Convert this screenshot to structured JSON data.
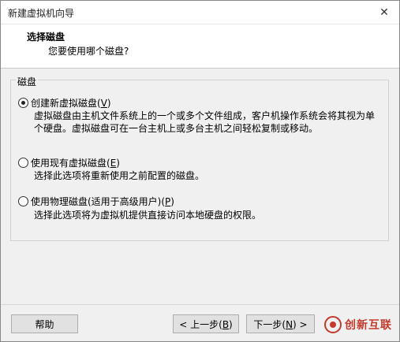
{
  "window": {
    "title": "新建虚拟机向导",
    "close_glyph": "✕"
  },
  "header": {
    "title": "选择磁盘",
    "subtitle": "您要使用哪个磁盘?"
  },
  "group": {
    "label": "磁盘"
  },
  "options": [
    {
      "label": "创建新虚拟磁盘(",
      "hotkey": "V",
      "suffix": ")",
      "checked": true,
      "desc_lines": [
        "虚拟磁盘由主机文件系统上的一个或多个文件组成，客户机操作系统会将其视为单",
        "个硬盘。虚拟磁盘可在一台主机上或多台主机之间轻松复制或移动。"
      ]
    },
    {
      "label": "使用现有虚拟磁盘(",
      "hotkey": "E",
      "suffix": ")",
      "checked": false,
      "desc_lines": [
        "选择此选项将重新使用之前配置的磁盘。"
      ]
    },
    {
      "label": "使用物理磁盘(适用于高级用户)(",
      "hotkey": "P",
      "suffix": ")",
      "checked": false,
      "desc_lines": [
        "选择此选项将为虚拟机提供直接访问本地硬盘的权限。"
      ]
    }
  ],
  "buttons": {
    "help": "帮助",
    "back_prefix": "< 上一步(",
    "back_hotkey": "B",
    "back_suffix": ")",
    "next_prefix": "下一步(",
    "next_hotkey": "N",
    "next_suffix": ") >"
  },
  "watermark": {
    "text": "创新互联",
    "icon": "logo-icon"
  }
}
